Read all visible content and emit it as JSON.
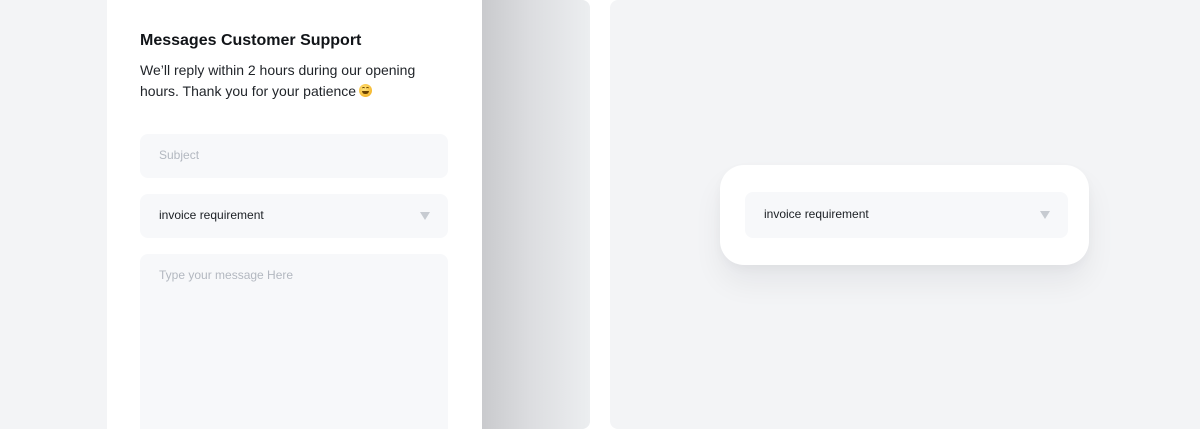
{
  "support_form": {
    "title": "Messages Customer Support",
    "description": "We’ll reply within 2 hours during our opening hours. Thank you for your patience",
    "emoji_icon": "grinning-face-icon",
    "subject": {
      "placeholder": "Subject",
      "value": ""
    },
    "topic_select": {
      "selected": "invoice requirement",
      "icon": "caret-down-icon"
    },
    "message": {
      "placeholder": "Type your message Here",
      "value": ""
    }
  },
  "dropdown_preview": {
    "selected": "invoice requirement",
    "icon": "caret-down-icon"
  },
  "colors": {
    "panel_background": "#f3f4f6",
    "card_background": "#ffffff",
    "field_background": "#f7f8fa",
    "placeholder_text": "#b3b8c0",
    "primary_text": "#111418",
    "caret": "#c7cbd1"
  }
}
